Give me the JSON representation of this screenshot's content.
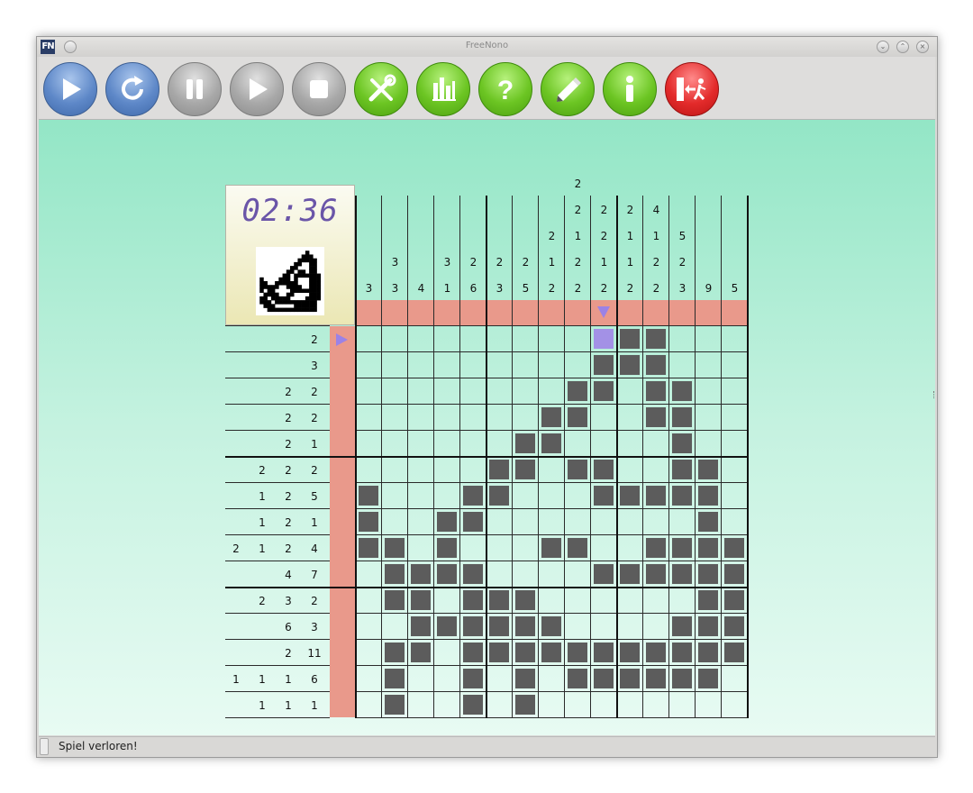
{
  "window": {
    "title": "FreeNono",
    "logo": "FN",
    "controls": [
      "minimize-icon",
      "maximize-icon",
      "close-icon"
    ]
  },
  "toolbar": {
    "buttons": [
      {
        "name": "start-button",
        "icon": "play-icon",
        "color": "#5e88c8"
      },
      {
        "name": "restart-button",
        "icon": "restart-icon",
        "color": "#5e88c8"
      },
      {
        "name": "pause-button",
        "icon": "pause-icon",
        "color": "#a8a8a8"
      },
      {
        "name": "resume-button",
        "icon": "play-icon",
        "color": "#a8a8a8"
      },
      {
        "name": "stop-button",
        "icon": "stop-icon",
        "color": "#a8a8a8"
      },
      {
        "name": "settings-button",
        "icon": "tools-icon",
        "color": "#6cc523"
      },
      {
        "name": "statistics-button",
        "icon": "statistics-icon",
        "color": "#6cc523"
      },
      {
        "name": "help-button",
        "icon": "question-icon",
        "color": "#6cc523"
      },
      {
        "name": "editor-button",
        "icon": "pencil-icon",
        "color": "#6cc523"
      },
      {
        "name": "about-button",
        "icon": "info-icon",
        "color": "#6cc523"
      },
      {
        "name": "exit-button",
        "icon": "exit-icon",
        "color": "#e32b2b"
      }
    ]
  },
  "game": {
    "timer": "02:36",
    "grid_size": 15,
    "column_clues": [
      [
        "3"
      ],
      [
        "3",
        "3"
      ],
      [
        "4"
      ],
      [
        "3",
        "1"
      ],
      [
        "2",
        "6"
      ],
      [
        "2",
        "3"
      ],
      [
        "2",
        "5"
      ],
      [
        "2",
        "1",
        "2"
      ],
      [
        "2",
        "2",
        "1",
        "2",
        "2"
      ],
      [
        "2",
        "2",
        "1",
        "2"
      ],
      [
        "2",
        "1",
        "1",
        "2"
      ],
      [
        "4",
        "1",
        "2",
        "2"
      ],
      [
        "5",
        "2",
        "3"
      ],
      [
        "9"
      ],
      [
        "5"
      ]
    ],
    "row_clues": [
      [
        "2"
      ],
      [
        "3"
      ],
      [
        "2",
        "2"
      ],
      [
        "2",
        "2"
      ],
      [
        "2",
        "1"
      ],
      [
        "2",
        "2",
        "2"
      ],
      [
        "1",
        "2",
        "5"
      ],
      [
        "1",
        "2",
        "1"
      ],
      [
        "2",
        "1",
        "2",
        "4"
      ],
      [
        "4",
        "7"
      ],
      [
        "2",
        "3",
        "2"
      ],
      [
        "6",
        "3"
      ],
      [
        "2",
        "11"
      ],
      [
        "1",
        "1",
        "1",
        "6"
      ],
      [
        "1",
        "1",
        "1"
      ]
    ],
    "board": [
      "000000000MXX000",
      "000000000XXX000",
      "00000000XX0XX00",
      "0000000XX00XX00",
      "000000XX0000X00",
      "00000XX0XX00XX0",
      "X000XX000XXXXX0",
      "X00XX00000000X0",
      "XX0X000XX00XXXX",
      "0XXXX0000XXXXXX",
      "0XX0XXX000000XX",
      "00XXXXXX0000XXX",
      "0XX0XXXXXXXXXXX",
      "0X00X0X0XXXXXX0",
      "0X00X0X00000000"
    ],
    "cursor": {
      "row": 1,
      "column": 10
    },
    "colors": {
      "filled": "#5c5c5c",
      "marked": "#a391e6",
      "highlight": "#e9998b",
      "marker": "#9b82e6"
    }
  },
  "preview_pixels": [
    "000000000000000000",
    "0000000000000X0000",
    "000000000000XXX000",
    "00000000000XXXXX00",
    "0000000000XX00XX00",
    "000000000XX000XX00",
    "00000000XX0XX0XX00",
    "0000000XX0XXXXXXX0",
    "0X0000XXX0X000XXX0",
    "0XX00XXXXXX000XXX0",
    "0XXXXX00XXXX00XXX0",
    "0X0XX0000XXXXXXXX0",
    "00XXXX00XX0000XXX0",
    "0XX0XXXXX0000XXXX0",
    "0XXX0XXXXXXXXXXX00",
    "00XXX00000XXXXXX00",
    "000XXXXXXXXXXXXX00",
    "000000000000000000"
  ],
  "status": {
    "message": "Spiel verloren!"
  }
}
